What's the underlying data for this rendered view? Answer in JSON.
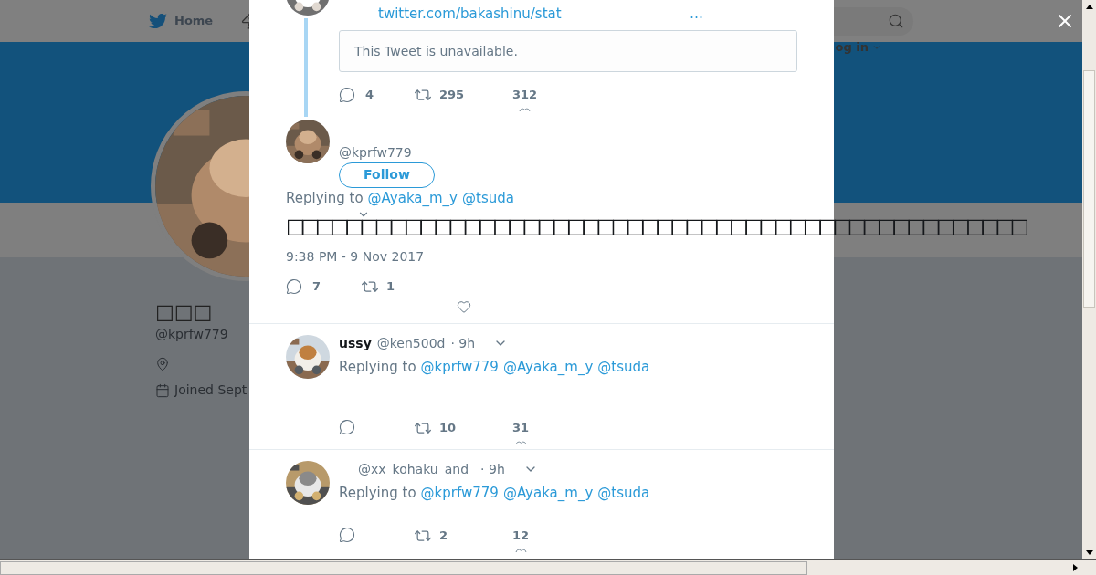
{
  "nav": {
    "home": "Home",
    "login": "og in"
  },
  "profile": {
    "name": "□□□",
    "handle": "@kprfw779",
    "joined": "Joined Sept"
  },
  "top_tweet": {
    "link": "twitter.com/bakashinu/stat",
    "more": "…",
    "quote": "This Tweet is unavailable.",
    "replies": "4",
    "retweets": "295",
    "likes": "312"
  },
  "main_tweet": {
    "handle": "@kprfw779",
    "follow": "Follow",
    "replying_label": "Replying to",
    "mentions": [
      "@Ayaka_m_y",
      "@tsuda"
    ],
    "text": "□□□□□□□□□□□□□□□□□□□□□□□□□□□□□□□□□□□□□□□□□□□□□□□□□□",
    "time": "9:38 PM - 9 Nov 2017",
    "replies": "7",
    "retweets": "1"
  },
  "replies": [
    {
      "name": "ussy",
      "handle": "@ken500d",
      "time": "· 9h",
      "replying_label": "Replying to",
      "mentions": [
        "@kprfw779",
        "@Ayaka_m_y",
        "@tsuda"
      ],
      "retweets": "10",
      "likes": "31"
    },
    {
      "handle": "@xx_kohaku_and_",
      "time": "· 9h",
      "replying_label": "Replying to",
      "mentions": [
        "@kprfw779",
        "@Ayaka_m_y",
        "@tsuda"
      ],
      "retweets": "2",
      "likes": "12"
    }
  ]
}
